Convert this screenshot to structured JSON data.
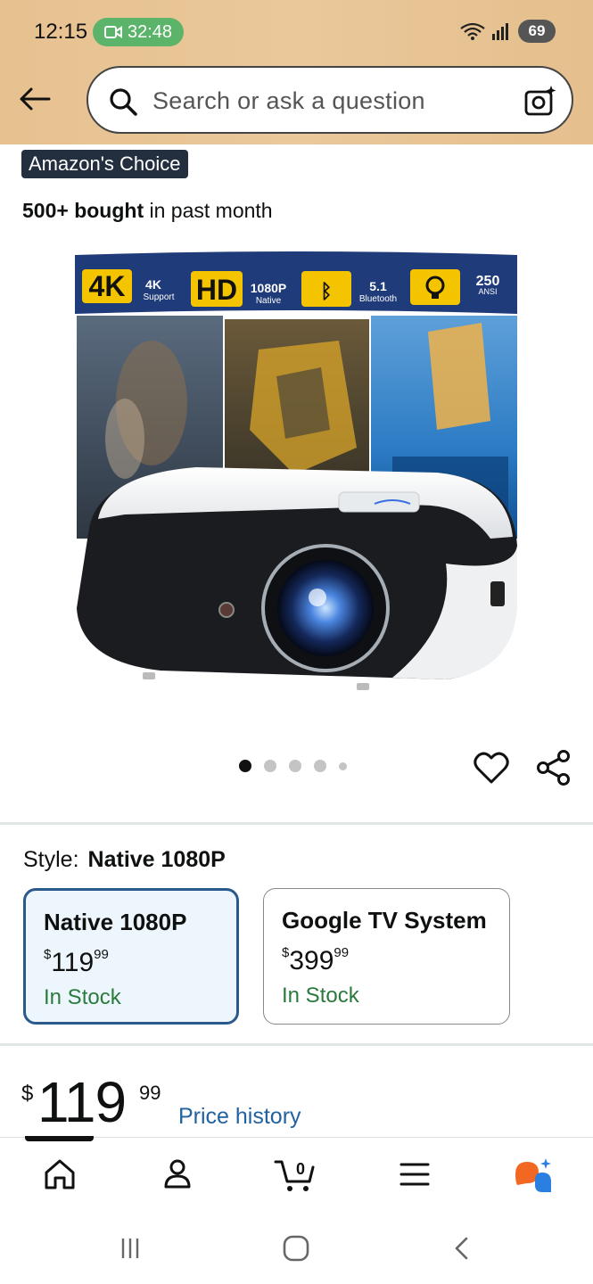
{
  "status_bar": {
    "time": "12:15",
    "call_timer": "32:48",
    "battery": "69",
    "signal_label": "6"
  },
  "search": {
    "placeholder": "Search or ask a question"
  },
  "product": {
    "badge": "Amazon's Choice",
    "bought_bold": "500+ bought",
    "bought_rest": " in past month",
    "image_banner": [
      {
        "big": "4K",
        "small": "4K",
        "sub": "Support"
      },
      {
        "big": "HD",
        "small": "1080P",
        "sub": "Native"
      },
      {
        "big": "BT",
        "small": "5.1",
        "sub": "Bluetooth"
      },
      {
        "big": "LIGHT",
        "small": "250",
        "sub": "ANSI"
      }
    ],
    "carousel": {
      "total": 5,
      "active": 1
    }
  },
  "style": {
    "label": "Style:",
    "selected": "Native 1080P",
    "options": [
      {
        "name": "Native 1080P",
        "symbol": "$",
        "whole": "119",
        "fraction": "99",
        "stock": "In Stock"
      },
      {
        "name": "Google TV System",
        "symbol": "$",
        "whole": "399",
        "fraction": "99",
        "stock": "In Stock"
      }
    ]
  },
  "price": {
    "symbol": "$",
    "whole": "119",
    "fraction": "99",
    "history_link": "Price history"
  },
  "bottom_nav": {
    "cart_count": "0",
    "items": [
      "home-icon",
      "account-icon",
      "cart-icon",
      "menu-icon",
      "rufus-icon"
    ]
  },
  "colors": {
    "header_bg": "#e8c494",
    "badge_bg": "#232f3e",
    "link": "#2162a1",
    "in_stock": "#2a7a3c",
    "selected_border": "#2a5a8c",
    "selected_bg": "#edf6fc",
    "rec_pill": "#5cb46a"
  }
}
